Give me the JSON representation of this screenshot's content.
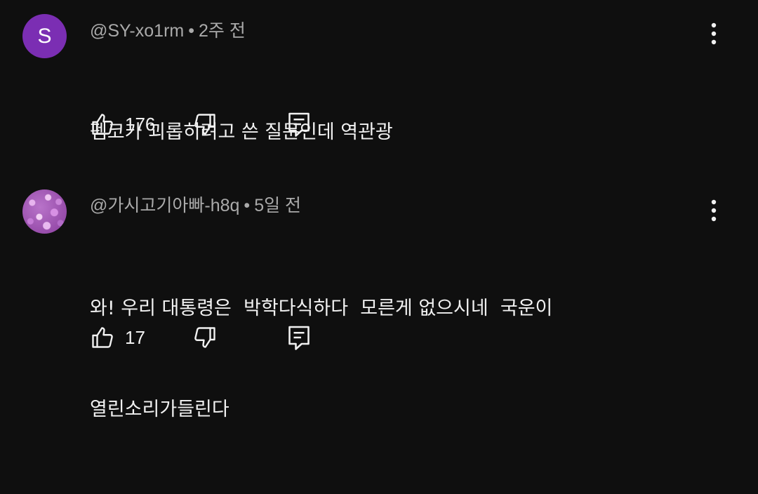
{
  "comments": [
    {
      "avatar_letter": "S",
      "avatar_color": "#7b2eb3",
      "author": "@SY-xo1rm",
      "time": "2주 전",
      "text_lines": [
        "펨코가 괴롭히려고 쓴 질문인데 역관광"
      ],
      "likes": "176",
      "icons": {
        "like": "thumbs-up-icon",
        "dislike": "thumbs-down-icon",
        "reply": "reply-icon",
        "more": "more-vert-icon"
      }
    },
    {
      "avatar_image": "pink-flowers",
      "author": "@가시고기아빠-h8q",
      "time": "5일 전",
      "text_lines": [
        "와! 우리 대통령은  박학다식하다  모른게 없으시네  국운이",
        "열린소리가들린다"
      ],
      "likes": "17",
      "icons": {
        "like": "thumbs-up-icon",
        "dislike": "thumbs-down-icon",
        "reply": "reply-icon",
        "more": "more-vert-icon"
      }
    }
  ],
  "meta_separator": "•",
  "colors": {
    "background": "#0f0f0f",
    "primary_text": "#f1f1f1",
    "secondary_text": "#aaaaaa"
  }
}
